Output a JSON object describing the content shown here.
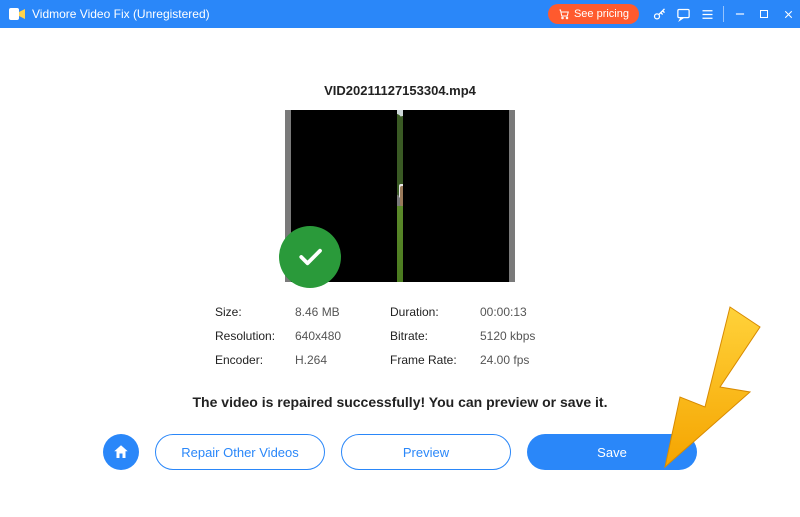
{
  "titlebar": {
    "app_name": "Vidmore Video Fix (Unregistered)",
    "see_pricing": "See pricing"
  },
  "file": {
    "name": "VID20211127153304.mp4"
  },
  "info": {
    "size_label": "Size:",
    "size_value": "8.46 MB",
    "duration_label": "Duration:",
    "duration_value": "00:00:13",
    "resolution_label": "Resolution:",
    "resolution_value": "640x480",
    "bitrate_label": "Bitrate:",
    "bitrate_value": "5120 kbps",
    "encoder_label": "Encoder:",
    "encoder_value": "H.264",
    "framerate_label": "Frame Rate:",
    "framerate_value": "24.00 fps"
  },
  "message": "The video is repaired successfully! You can preview or save it.",
  "buttons": {
    "repair_other": "Repair Other Videos",
    "preview": "Preview",
    "save": "Save"
  },
  "colors": {
    "primary": "#2a87f9",
    "accent": "#ff5a2e",
    "success": "#2a9a3a"
  }
}
